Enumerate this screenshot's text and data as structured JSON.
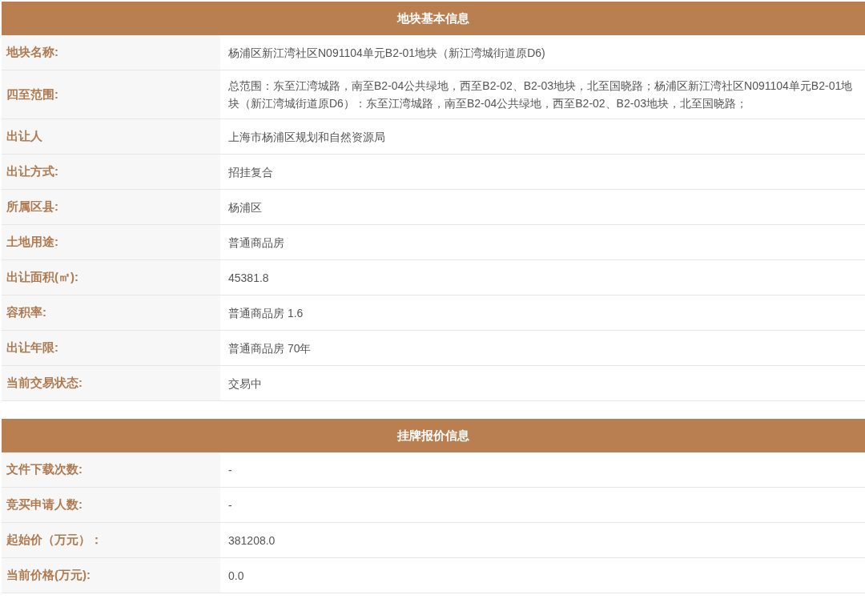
{
  "tables": [
    {
      "title": "地块基本信息",
      "rows": [
        {
          "label": "地块名称:",
          "value": "杨浦区新江湾社区N091104单元B2-01地块（新江湾城街道原D6)"
        },
        {
          "label": "四至范围:",
          "value": "总范围：东至江湾城路，南至B2-04公共绿地，西至B2-02、B2-03地块，北至国晓路；杨浦区新江湾社区N091104单元B2-01地块（新江湾城街道原D6）：东至江湾城路，南至B2-04公共绿地，西至B2-02、B2-03地块，北至国晓路；"
        },
        {
          "label": "出让人",
          "value": "上海市杨浦区规划和自然资源局"
        },
        {
          "label": "出让方式:",
          "value": "招挂复合"
        },
        {
          "label": "所属区县:",
          "value": "杨浦区"
        },
        {
          "label": "土地用途:",
          "value": "普通商品房"
        },
        {
          "label": "出让面积(㎡):",
          "value": "45381.8"
        },
        {
          "label": "容积率:",
          "value": "普通商品房 1.6"
        },
        {
          "label": "出让年限:",
          "value": "普通商品房 70年"
        },
        {
          "label": "当前交易状态:",
          "value": "交易中"
        }
      ]
    },
    {
      "title": "挂牌报价信息",
      "rows": [
        {
          "label": "文件下载次数:",
          "value": "-"
        },
        {
          "label": "竞买申请人数:",
          "value": "-"
        },
        {
          "label": "起始价（万元）：",
          "value": "381208.0"
        },
        {
          "label": "当前价格(万元):",
          "value": "0.0"
        }
      ]
    }
  ]
}
